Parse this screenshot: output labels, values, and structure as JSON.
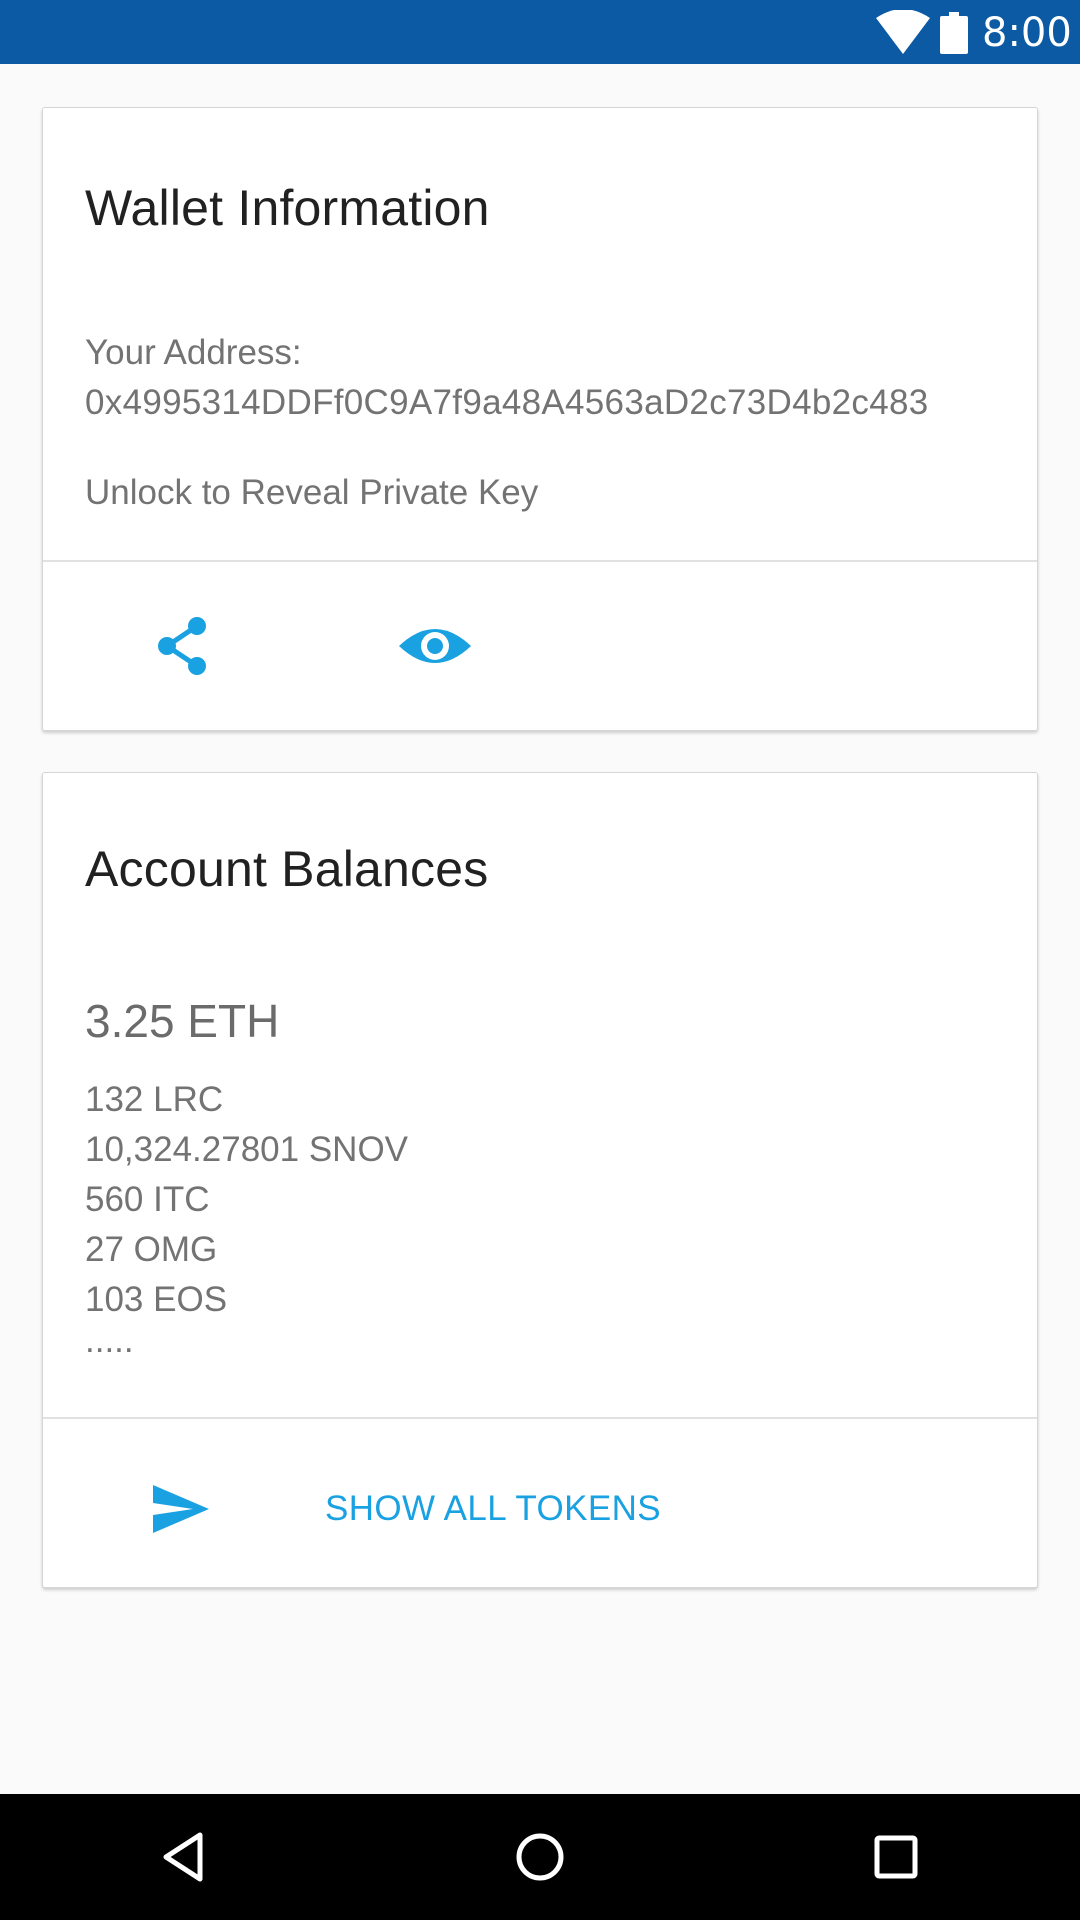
{
  "status_bar": {
    "time": "8:00",
    "icons": [
      "wifi-icon",
      "battery-icon"
    ],
    "background_color": "#0b5aa3"
  },
  "wallet_card": {
    "title": "Wallet Information",
    "address_label": "Your Address:",
    "address": "0x4995314DDFf0C9A7f9a48A4563aD2c73D4b2c483",
    "unlock_text": "Unlock to Reveal Private Key",
    "actions": [
      {
        "icon": "share-icon"
      },
      {
        "icon": "eye-icon"
      }
    ]
  },
  "balances_card": {
    "title": "Account Balances",
    "eth_balance": "3.25 ETH",
    "tokens": [
      "132 LRC",
      "10,324.27801 SNOV",
      "560 ITC",
      "27 OMG",
      "103 EOS"
    ],
    "more_indicator": ".....",
    "send_icon": "send-icon",
    "show_all_label": "SHOW ALL TOKENS"
  },
  "nav_bar": {
    "buttons": [
      "back-icon",
      "home-icon",
      "recents-icon"
    ]
  },
  "colors": {
    "accent": "#1aa1e1",
    "title_text": "#212121",
    "secondary_text": "#737373"
  }
}
